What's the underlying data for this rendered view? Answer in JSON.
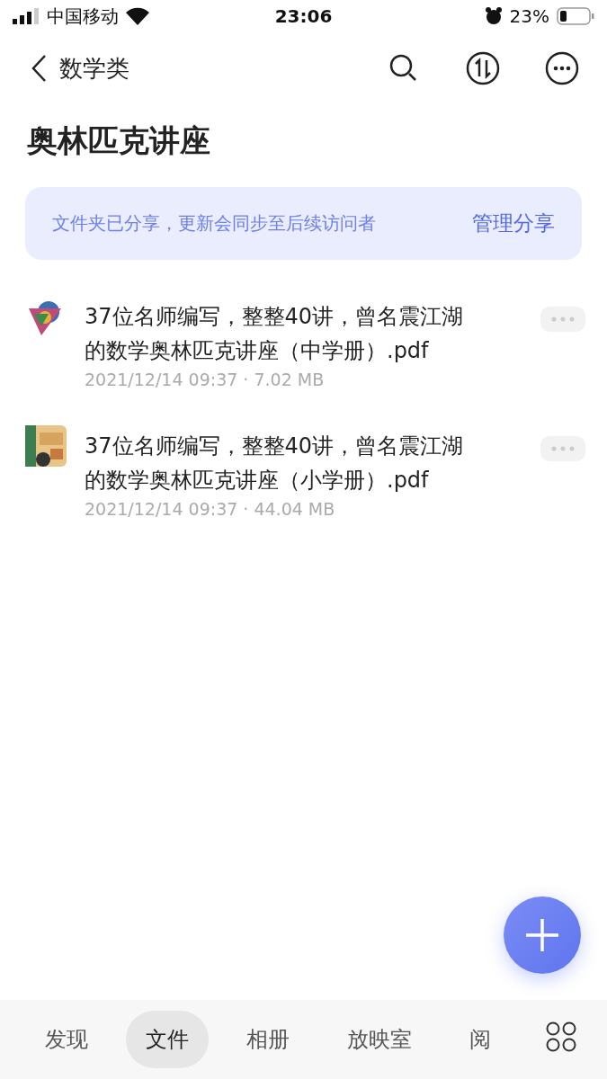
{
  "status_bar": {
    "carrier": "中国移动",
    "time": "23:06",
    "battery": "23%"
  },
  "nav": {
    "title": "数学类"
  },
  "folder_title": "奥林匹克讲座",
  "share_banner": {
    "message": "文件夹已分享，更新会同步至后续访问者",
    "action": "管理分享"
  },
  "files": [
    {
      "name": "37位名师编写，整整40讲，曾名震江湖的数学奥林匹克讲座（中学册）.pdf",
      "meta": "2021/12/14 09:37 · 7.02 MB"
    },
    {
      "name": "37位名师编写，整整40讲，曾名震江湖的数学奥林匹克讲座（小学册）.pdf",
      "meta": "2021/12/14 09:37 · 44.04 MB"
    }
  ],
  "tabs": [
    {
      "label": "发现",
      "selected": false
    },
    {
      "label": "文件",
      "selected": true
    },
    {
      "label": "相册",
      "selected": false
    },
    {
      "label": "放映室",
      "selected": false
    },
    {
      "label": "阅",
      "selected": false
    }
  ]
}
